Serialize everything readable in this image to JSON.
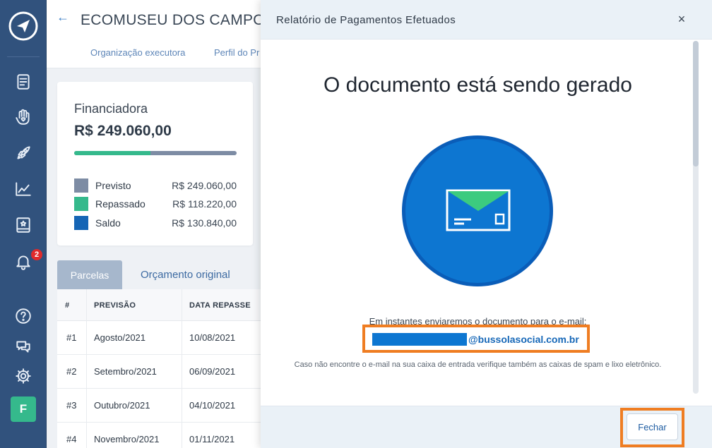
{
  "sidebar": {
    "badge_count": "2",
    "avatar_letter": "F",
    "icons": [
      "document-icon",
      "hand-heart-icon",
      "rocket-icon",
      "chart-icon",
      "book-icon",
      "bell-icon",
      "help-icon",
      "chat-icon",
      "gear-icon"
    ]
  },
  "header": {
    "title": "ECOMUSEU DOS CAMPO",
    "tabs": [
      "Organização executora",
      "Perfil do Pr"
    ]
  },
  "finance_card": {
    "label": "Financiadora",
    "amount": "R$ 249.060,00",
    "progress_fraction": 0.47,
    "legend": [
      {
        "name": "Previsto",
        "value": "R$ 249.060,00",
        "color": "#7d8ca4"
      },
      {
        "name": "Repassado",
        "value": "R$ 118.220,00",
        "color": "#35b98c"
      },
      {
        "name": "Saldo",
        "value": "R$ 130.840,00",
        "color": "#1565b5"
      }
    ]
  },
  "table_tabs": {
    "active": "Parcelas",
    "inactive": "Orçamento original"
  },
  "table": {
    "columns": [
      "#",
      "PREVISÃO",
      "DATA REPASSE"
    ],
    "rows": [
      [
        "#1",
        "Agosto/2021",
        "10/08/2021"
      ],
      [
        "#2",
        "Setembro/2021",
        "06/09/2021"
      ],
      [
        "#3",
        "Outubro/2021",
        "04/10/2021"
      ],
      [
        "#4",
        "Novembro/2021",
        "01/11/2021"
      ]
    ]
  },
  "modal": {
    "title": "Relatório de Pagamentos Efetuados",
    "close_icon": "×",
    "heading": "O documento está sendo gerado",
    "info": "Em instantes enviaremos o documento para o e-mail:",
    "email_domain": "@bussolasocial.com.br",
    "note": "Caso não encontre o e-mail na sua caixa de entrada verifique também as caixas de spam e lixo eletrônico.",
    "close_button": "Fechar",
    "accent": "#0d76d1",
    "highlight": "#ef7d22"
  }
}
